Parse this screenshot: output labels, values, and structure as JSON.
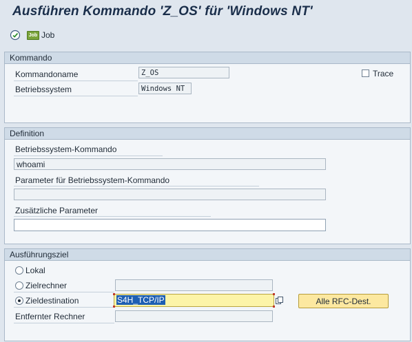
{
  "page": {
    "title": "Ausführen Kommando 'Z_OS' für 'Windows NT'"
  },
  "toolbar": {
    "execute_icon": "execute-clock-icon",
    "job_icon_text": "Job",
    "job_label": "Job"
  },
  "kommando": {
    "header": "Kommando",
    "name_label": "Kommandoname",
    "name_value": "Z_OS",
    "os_label": "Betriebssystem",
    "os_value": "Windows NT",
    "trace_label": "Trace",
    "trace_checked": false
  },
  "definition": {
    "header": "Definition",
    "cmd_label": "Betriebssystem-Kommando",
    "cmd_value": "whoami",
    "param_label": "Parameter für Betriebssystem-Kommando",
    "param_value": "",
    "extra_label": "Zusätzliche Parameter",
    "extra_value": ""
  },
  "ziel": {
    "header": "Ausführungsziel",
    "lokal_label": "Lokal",
    "zielrechner_label": "Zielrechner",
    "zielrechner_value": "",
    "zieldestination_label": "Zieldestination",
    "zieldestination_value": "S4H_TCP/IP",
    "selected": "zieldestination",
    "entfernter_label": "Entfernter Rechner",
    "entfernter_value": "",
    "alle_rfc_button": "Alle RFC-Dest."
  },
  "colors": {
    "background": "#dfe6ee",
    "group_header": "#cfdbe7",
    "highlight_field": "#fcf4a8",
    "button": "#fce8a0"
  }
}
